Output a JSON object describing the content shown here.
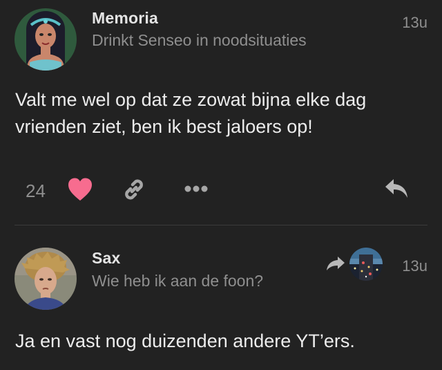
{
  "posts": [
    {
      "username": "Memoria",
      "user_title": "Drinkt Senseo in noodsituaties",
      "time": "13u",
      "content": "Valt me wel op dat ze zowat bijna elke dag vrienden ziet, ben ik best jaloers op!",
      "likes": "24",
      "liked": true
    },
    {
      "username": "Sax",
      "user_title": "Wie heb ik aan de foon?",
      "time": "13u",
      "content": "Ja en vast nog duizenden andere YT’ers."
    }
  ],
  "colors": {
    "background": "#222222",
    "text": "#ececec",
    "muted": "#8f8f8f",
    "heart": "#f76c8f",
    "icon": "#a6a6a6"
  },
  "icons": {
    "like": "heart-icon",
    "share_link": "link-icon",
    "more": "more-dots-icon",
    "reply": "reply-icon",
    "reply_to": "reply-to-arrow-icon"
  }
}
